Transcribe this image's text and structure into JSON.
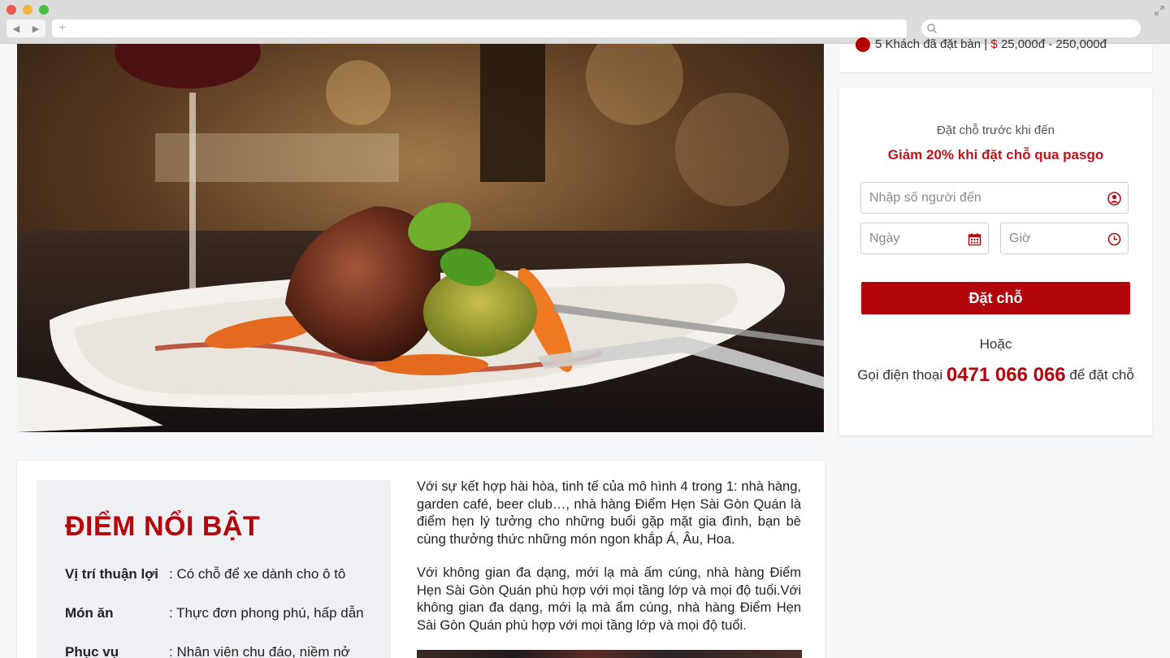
{
  "browser": {
    "back_icon": "back-arrow-icon",
    "forward_icon": "forward-arrow-icon",
    "new_tab_symbol": "+",
    "url": "",
    "search_icon": "search-icon",
    "expand_icon": "expand-icon"
  },
  "info": {
    "line_text": "5 Khách đã đặt bàn | ",
    "price_symbol": "$",
    "price_range": " 25,000đ - 250,000đ"
  },
  "booking": {
    "title": "Đặt chỗ trước khi đến",
    "promo": "Giảm 20% khi đặt chỗ qua pasgo",
    "guests_placeholder": "Nhập số người đến",
    "date_placeholder": "Ngày",
    "time_placeholder": "Giờ",
    "button_label": "Đặt chỗ",
    "or_label": "Hoặc",
    "call_prefix": "Gọi điện thoại ",
    "phone": "0471 066 066",
    "call_suffix": " để đặt chỗ",
    "accent_color": "#b3050c"
  },
  "highlights": {
    "title": "ĐIỂM NỔI BẬT",
    "rows": [
      {
        "key": "Vị trí thuận lợi",
        "value": ": Có chỗ để xe dành cho ô tô"
      },
      {
        "key": "Món ăn",
        "value": ": Thực đơn phong phú, hấp dẫn"
      },
      {
        "key": "Phục vụ",
        "value": ": Nhân viên chu đáo, niềm nở"
      }
    ]
  },
  "description": {
    "p1": "Với sự kết hợp hài hòa, tinh tế của mô hình 4 trong 1: nhà hàng, garden café, beer club…, nhà hàng Điểm Hẹn Sài Gòn Quán là điểm hẹn lý tưởng cho những buổi gặp mặt gia đình, bạn bè cùng thưởng thức những món ngon khắp Á, Âu, Hoa.",
    "p2": "Với không gian đa dạng, mới lạ mà ấm cúng, nhà hàng Điểm Hẹn Sài Gòn Quán phù hợp với mọi tầng lớp và mọi độ tuổi.Với không gian đa dạng, mới lạ mà ấm cúng, nhà hàng Điểm Hẹn Sài Gòn Quán phù hợp với mọi tầng lớp và mọi độ tuổi."
  }
}
